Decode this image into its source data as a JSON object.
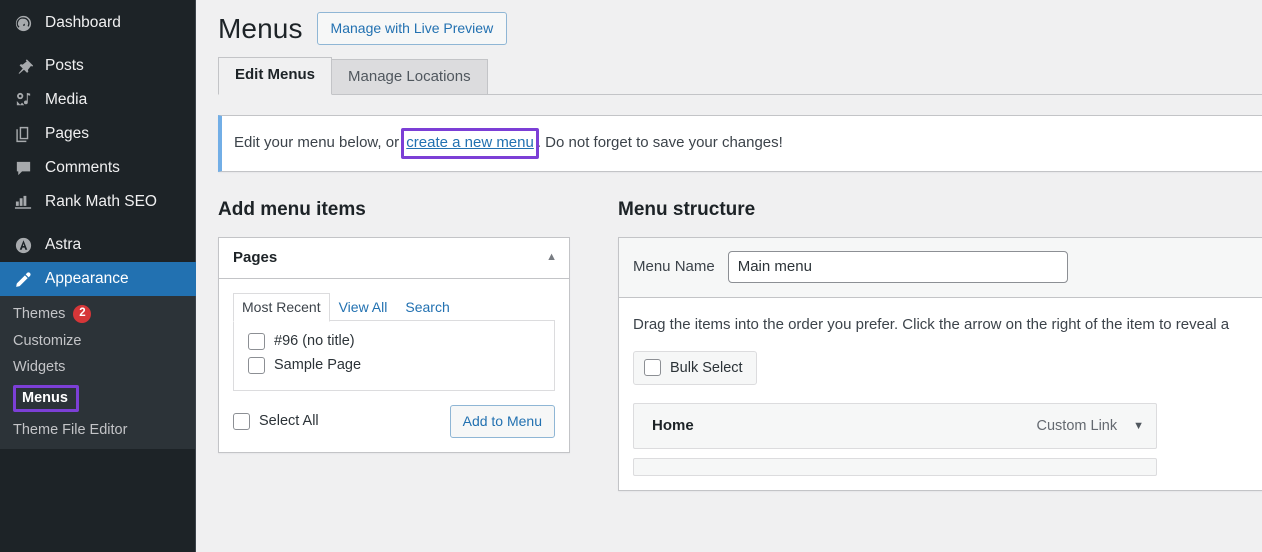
{
  "sidebar": {
    "primary": [
      {
        "label": "Dashboard",
        "icon": "dashboard-icon",
        "current": false
      },
      {
        "label": "Posts",
        "icon": "pin-icon",
        "current": false
      },
      {
        "label": "Media",
        "icon": "media-icon",
        "current": false
      },
      {
        "label": "Pages",
        "icon": "pages-icon",
        "current": false
      },
      {
        "label": "Comments",
        "icon": "comments-icon",
        "current": false
      },
      {
        "label": "Rank Math SEO",
        "icon": "rank-math-icon",
        "current": false
      },
      {
        "label": "Astra",
        "icon": "astra-icon",
        "current": false
      },
      {
        "label": "Appearance",
        "icon": "paintbrush-icon",
        "current": true
      }
    ],
    "submenu": [
      {
        "label": "Themes",
        "badge": "2",
        "selected": false
      },
      {
        "label": "Customize",
        "badge": "",
        "selected": false
      },
      {
        "label": "Widgets",
        "badge": "",
        "selected": false
      },
      {
        "label": "Menus",
        "badge": "",
        "selected": true
      },
      {
        "label": "Theme File Editor",
        "badge": "",
        "selected": false
      }
    ]
  },
  "header": {
    "title": "Menus",
    "live_preview_label": "Manage with Live Preview",
    "tabs": [
      {
        "label": "Edit Menus",
        "active": true
      },
      {
        "label": "Manage Locations",
        "active": false
      }
    ]
  },
  "notice": {
    "text_before": "Edit your menu below, or ",
    "link_label": "create a new menu",
    "text_after": ". Do not forget to save your changes!"
  },
  "add_menu_items": {
    "heading": "Add menu items",
    "pages_box": {
      "title": "Pages",
      "toggle_icon": "chevron-up-icon",
      "tabs": [
        {
          "label": "Most Recent",
          "active": true
        },
        {
          "label": "View All",
          "active": false
        },
        {
          "label": "Search",
          "active": false
        }
      ],
      "items": [
        {
          "label": "#96 (no title)",
          "checked": false
        },
        {
          "label": "Sample Page",
          "checked": false
        }
      ],
      "select_all_label": "Select All",
      "add_to_menu_label": "Add to Menu"
    }
  },
  "menu_structure": {
    "heading": "Menu structure",
    "menu_name_label": "Menu Name",
    "menu_name_value": "Main menu",
    "menu_name_placeholder": "Menu Name",
    "hint": "Drag the items into the order you prefer. Click the arrow on the right of the item to reveal a",
    "bulk_select_label": "Bulk Select",
    "items": [
      {
        "title": "Home",
        "type": "Custom Link",
        "arrow_icon": "chevron-down-icon"
      }
    ]
  },
  "colors": {
    "sidebar_bg": "#1d2327",
    "submenu_bg": "#2c3338",
    "accent_blue": "#2271b1",
    "highlight_purple": "#7c3fd6",
    "badge_red": "#d63638",
    "page_bg": "#f0f0f1"
  }
}
